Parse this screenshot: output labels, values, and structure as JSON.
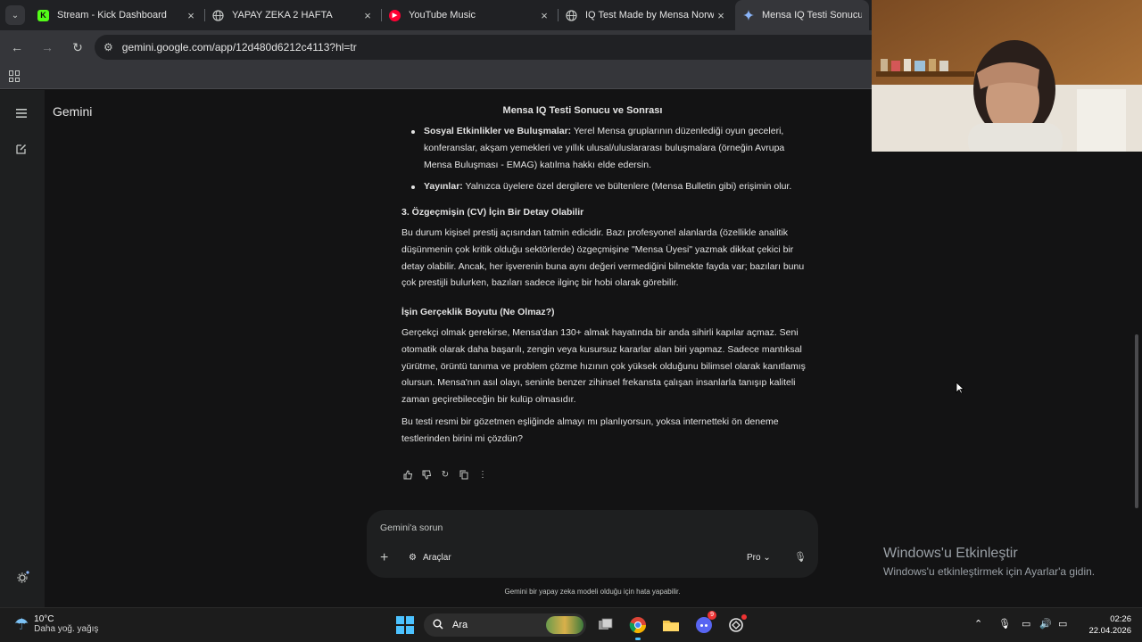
{
  "browser": {
    "tabs": [
      {
        "title": "Stream - Kick Dashboard",
        "favicon": "kick-icon",
        "color": "#53fc18"
      },
      {
        "title": "YAPAY ZEKA 2 HAFTA",
        "favicon": "globe-icon",
        "color": "#9aa0a6"
      },
      {
        "title": "YouTube Music",
        "favicon": "youtube-music-icon",
        "color": "#ff0033"
      },
      {
        "title": "IQ Test Made by Mensa Norwa",
        "favicon": "globe-icon",
        "color": "#9aa0a6"
      },
      {
        "title": "Mensa IQ Testi Sonucu ve So",
        "favicon": "gemini-icon",
        "color": "#8ab4f8"
      }
    ],
    "url": "gemini.google.com/app/12d480d6212c4113?hl=tr"
  },
  "gemini": {
    "brand": "Gemini",
    "conversation_title": "Mensa IQ Testi Sonucu ve Sonrası",
    "response": {
      "bullet_1_bold": "Sosyal Etkinlikler ve Buluşmalar:",
      "bullet_1_text": " Yerel Mensa gruplarının düzenlediği oyun geceleri, konferanslar, akşam yemekleri ve yıllık ulusal/uluslararası buluşmalara (örneğin Avrupa Mensa Buluşması - EMAG) katılma hakkı elde edersin.",
      "bullet_2_bold": "Yayınlar:",
      "bullet_2_text": " Yalnızca üyelere özel dergilere ve bültenlere (Mensa Bulletin gibi) erişimin olur.",
      "heading_3": "3. Özgeçmişin (CV) İçin Bir Detay Olabilir",
      "paragraph_3": "Bu durum kişisel prestij açısından tatmin edicidir. Bazı profesyonel alanlarda (özellikle analitik düşünmenin çok kritik olduğu sektörlerde) özgeçmişine \"Mensa Üyesi\" yazmak dikkat çekici bir detay olabilir. Ancak, her işverenin buna aynı değeri vermediğini bilmekte fayda var; bazıları bunu çok prestijli bulurken, bazıları sadece ilginç bir hobi olarak görebilir.",
      "heading_4": "İşin Gerçeklik Boyutu (Ne Olmaz?)",
      "paragraph_4": "Gerçekçi olmak gerekirse, Mensa'dan 130+ almak hayatında bir anda sihirli kapılar açmaz. Seni otomatik olarak daha başarılı, zengin veya kusursuz kararlar alan biri yapmaz. Sadece mantıksal yürütme, örüntü tanıma ve problem çözme hızının çok yüksek olduğunu bilimsel olarak kanıtlamış olursun. Mensa'nın asıl olayı, seninle benzer zihinsel frekansta çalışan insanlarla tanışıp kaliteli zaman geçirebileceğin bir kulüp olmasıdır.",
      "paragraph_5": "Bu testi resmi bir gözetmen eşliğinde almayı mı planlıyorsun, yoksa internetteki ön deneme testlerinden birini mi çözdün?"
    },
    "composer": {
      "placeholder": "Gemini'a sorun",
      "tools_label": "Araçlar",
      "model_label": "Pro"
    },
    "disclaimer": "Gemini bir yapay zeka modeli olduğu için hata yapabilir."
  },
  "windows_watermark": {
    "title": "Windows'u Etkinleştir",
    "subtitle": "Windows'u etkinleştirmek için Ayarlar'a gidin."
  },
  "taskbar": {
    "weather_temp": "10°C",
    "weather_desc": "Daha yoğ. yağış",
    "search_label": "Ara",
    "time": "02:26",
    "date": "22.04.2026",
    "discord_badge": "9"
  }
}
